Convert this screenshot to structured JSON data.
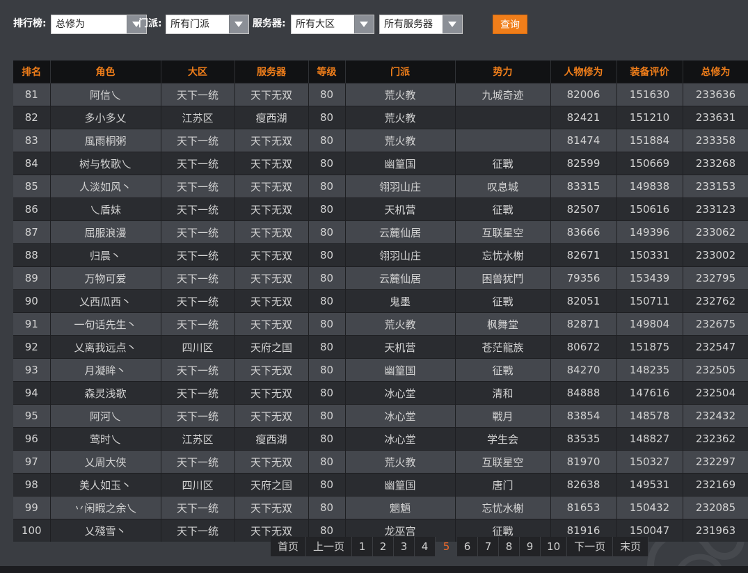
{
  "filters": {
    "rank_label": "排行榜:",
    "rank_value": "总修为",
    "sect_label": "门派:",
    "sect_value": "所有门派",
    "server_label": "服务器:",
    "region_value": "所有大区",
    "server_value": "所有服务器",
    "query_button": "查询"
  },
  "table": {
    "columns": [
      "排名",
      "角色",
      "大区",
      "服务器",
      "等级",
      "门派",
      "势力",
      "人物修为",
      "装备评价",
      "总修为"
    ],
    "rows": [
      [
        "81",
        "阿信乀",
        "天下一统",
        "天下无双",
        "80",
        "荒火教",
        "九城奇迹",
        "82006",
        "151630",
        "233636"
      ],
      [
        "82",
        "多小多乂",
        "江苏区",
        "瘦西湖",
        "80",
        "荒火教",
        "",
        "82421",
        "151210",
        "233631"
      ],
      [
        "83",
        "風雨桐粥",
        "天下一统",
        "天下无双",
        "80",
        "荒火教",
        "",
        "81474",
        "151884",
        "233358"
      ],
      [
        "84",
        "树与牧歌乀",
        "天下一统",
        "天下无双",
        "80",
        "幽篁国",
        "征戰",
        "82599",
        "150669",
        "233268"
      ],
      [
        "85",
        "人淡如风丶",
        "天下一统",
        "天下无双",
        "80",
        "翎羽山庄",
        "叹息城",
        "83315",
        "149838",
        "233153"
      ],
      [
        "86",
        "乀盾妹",
        "天下一统",
        "天下无双",
        "80",
        "天机营",
        "征戰",
        "82507",
        "150616",
        "233123"
      ],
      [
        "87",
        "屈服浪漫",
        "天下一统",
        "天下无双",
        "80",
        "云麓仙居",
        "互联星空",
        "83666",
        "149396",
        "233062"
      ],
      [
        "88",
        "归晨丶",
        "天下一统",
        "天下无双",
        "80",
        "翎羽山庄",
        "忘忧水榭",
        "82671",
        "150331",
        "233002"
      ],
      [
        "89",
        "万物可爱",
        "天下一统",
        "天下无双",
        "80",
        "云麓仙居",
        "困兽犹鬥",
        "79356",
        "153439",
        "232795"
      ],
      [
        "90",
        "乂西瓜西丶",
        "天下一统",
        "天下无双",
        "80",
        "鬼墨",
        "征戰",
        "82051",
        "150711",
        "232762"
      ],
      [
        "91",
        "一句话先生丶",
        "天下一统",
        "天下无双",
        "80",
        "荒火教",
        "枫舞堂",
        "82871",
        "149804",
        "232675"
      ],
      [
        "92",
        "乂离我远点丶",
        "四川区",
        "天府之国",
        "80",
        "天机营",
        "苍茫龍族",
        "80672",
        "151875",
        "232547"
      ],
      [
        "93",
        "月凝眸丶",
        "天下一统",
        "天下无双",
        "80",
        "幽篁国",
        "征戰",
        "84270",
        "148235",
        "232505"
      ],
      [
        "94",
        "森灵浅歌",
        "天下一统",
        "天下无双",
        "80",
        "冰心堂",
        "清和",
        "84888",
        "147616",
        "232504"
      ],
      [
        "95",
        "阿河乀",
        "天下一统",
        "天下无双",
        "80",
        "冰心堂",
        "戰月",
        "83854",
        "148578",
        "232432"
      ],
      [
        "96",
        "莺时乀",
        "江苏区",
        "瘦西湖",
        "80",
        "冰心堂",
        "学生会",
        "83535",
        "148827",
        "232362"
      ],
      [
        "97",
        "乂周大侠",
        "天下一统",
        "天下无双",
        "80",
        "荒火教",
        "互联星空",
        "81970",
        "150327",
        "232297"
      ],
      [
        "98",
        "美人如玉丶",
        "四川区",
        "天府之国",
        "80",
        "幽篁国",
        "唐门",
        "82638",
        "149531",
        "232169"
      ],
      [
        "99",
        "丷闲暇之余乀",
        "天下一统",
        "天下无双",
        "80",
        "魍魉",
        "忘忧水榭",
        "81653",
        "150432",
        "232085"
      ],
      [
        "100",
        "乂殘雪丶",
        "天下一统",
        "天下无双",
        "80",
        "龙巫宫",
        "征戰",
        "81916",
        "150047",
        "231963"
      ]
    ]
  },
  "pagination": {
    "first": "首页",
    "prev": "上一页",
    "pages": [
      "1",
      "2",
      "3",
      "4",
      "5",
      "6",
      "7",
      "8",
      "9",
      "10"
    ],
    "current": "5",
    "next": "下一页",
    "last": "末页"
  },
  "colors": {
    "accent": "#f07e1a",
    "current_page": "#f26a2a",
    "background": "#3a3d42"
  },
  "icons": {
    "dropdown": "triangle-down-icon"
  }
}
